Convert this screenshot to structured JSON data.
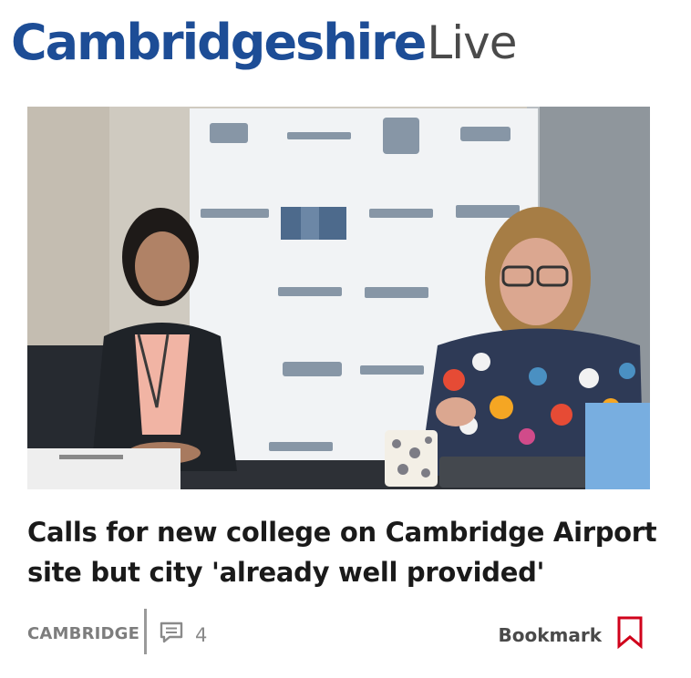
{
  "brand": {
    "name_main": "Cambridgeshire",
    "name_suffix": "Live",
    "main_color": "#1d4d96",
    "suffix_color": "#4a4a4a"
  },
  "article": {
    "image_icon": "photo-of-two-women-at-a-council-meeting-table",
    "headline": "Calls for new college on Cambridge Airport site but city 'already well provided'",
    "category": "CAMBRIDGE",
    "comment_icon": "speech-bubble-icon",
    "comment_count": "4",
    "bookmark_label": "Bookmark",
    "bookmark_icon": "bookmark-icon",
    "accent_color": "#d0021b"
  }
}
